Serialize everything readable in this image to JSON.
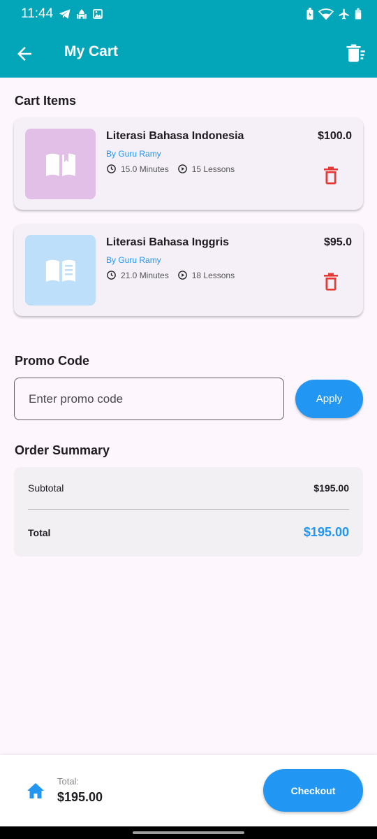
{
  "status_bar": {
    "time": "11:44"
  },
  "appbar": {
    "title": "My Cart"
  },
  "cart": {
    "section_title": "Cart Items",
    "items": [
      {
        "title": "Literasi Bahasa Indonesia",
        "author": "By Guru Ramy",
        "duration": "15.0 Minutes",
        "lessons": "15 Lessons",
        "price": "$100.0",
        "icon": "open-book-icon",
        "thumb_color": "#e1bfe7"
      },
      {
        "title": "Literasi Bahasa Inggris",
        "author": "By Guru Ramy",
        "duration": "21.0 Minutes",
        "lessons": "18 Lessons",
        "price": "$95.0",
        "icon": "book-lines-icon",
        "thumb_color": "#bedff9"
      }
    ]
  },
  "promo": {
    "section_title": "Promo Code",
    "placeholder": "Enter promo code",
    "value": "",
    "apply_label": "Apply"
  },
  "summary": {
    "section_title": "Order Summary",
    "subtotal_label": "Subtotal",
    "subtotal_value": "$195.00",
    "total_label": "Total",
    "total_value": "$195.00"
  },
  "bottom_bar": {
    "total_label": "Total:",
    "total_value": "$195.00",
    "checkout_label": "Checkout"
  },
  "colors": {
    "primary": "#03a5b8",
    "accent": "#2196f3",
    "danger": "#e53935",
    "background": "#fdf6fd"
  }
}
